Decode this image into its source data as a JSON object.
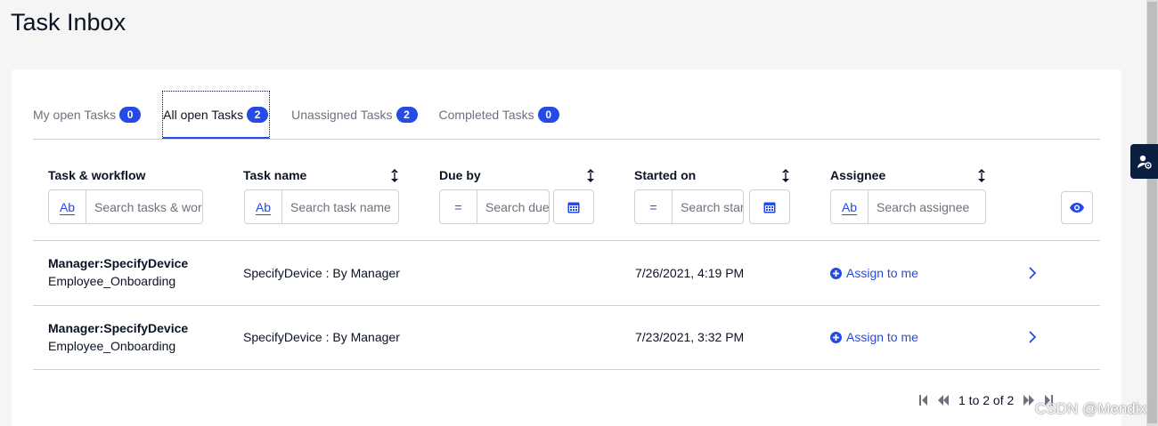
{
  "page": {
    "title": "Task Inbox"
  },
  "tabs": [
    {
      "label": "My open Tasks",
      "count": "0"
    },
    {
      "label": "All open Tasks",
      "count": "2"
    },
    {
      "label": "Unassigned Tasks",
      "count": "2"
    },
    {
      "label": "Completed Tasks",
      "count": "0"
    }
  ],
  "active_tab": "All open Tasks",
  "columns": [
    {
      "label": "Task & workflow",
      "filter_button": "Ab",
      "placeholder": "Search tasks & workflows"
    },
    {
      "label": "Task name",
      "filter_button": "Ab",
      "placeholder": "Search task name"
    },
    {
      "label": "Due by",
      "filter_button": "=",
      "placeholder": "Search due by"
    },
    {
      "label": "Started on",
      "filter_button": "=",
      "placeholder": "Search started on"
    },
    {
      "label": "Assignee",
      "filter_button": "Ab",
      "placeholder": "Search assignee"
    }
  ],
  "rows": [
    {
      "task": "Manager:SpecifyDevice",
      "workflow": "Employee_Onboarding",
      "task_name": "SpecifyDevice : By Manager",
      "due_by": "",
      "started_on": "7/26/2021, 4:19 PM",
      "assign_label": "Assign to me"
    },
    {
      "task": "Manager:SpecifyDevice",
      "workflow": "Employee_Onboarding",
      "task_name": "SpecifyDevice : By Manager",
      "due_by": "",
      "started_on": "7/23/2021, 3:32 PM",
      "assign_label": "Assign to me"
    }
  ],
  "pagination": {
    "text": "1 to 2 of 2"
  },
  "watermark": "CSDN @Mendix",
  "colors": {
    "accent": "#264ae5",
    "text": "#0a1325",
    "muted": "#6c717e",
    "border": "#ced0d3",
    "side_tab": "#0a1f3f"
  },
  "icons": [
    "user-settings-icon",
    "sort-icon",
    "calendar-icon",
    "eye-icon",
    "plus-circle-icon",
    "chevron-right-icon",
    "first-page-icon",
    "previous-page-icon",
    "next-page-icon",
    "last-page-icon"
  ]
}
